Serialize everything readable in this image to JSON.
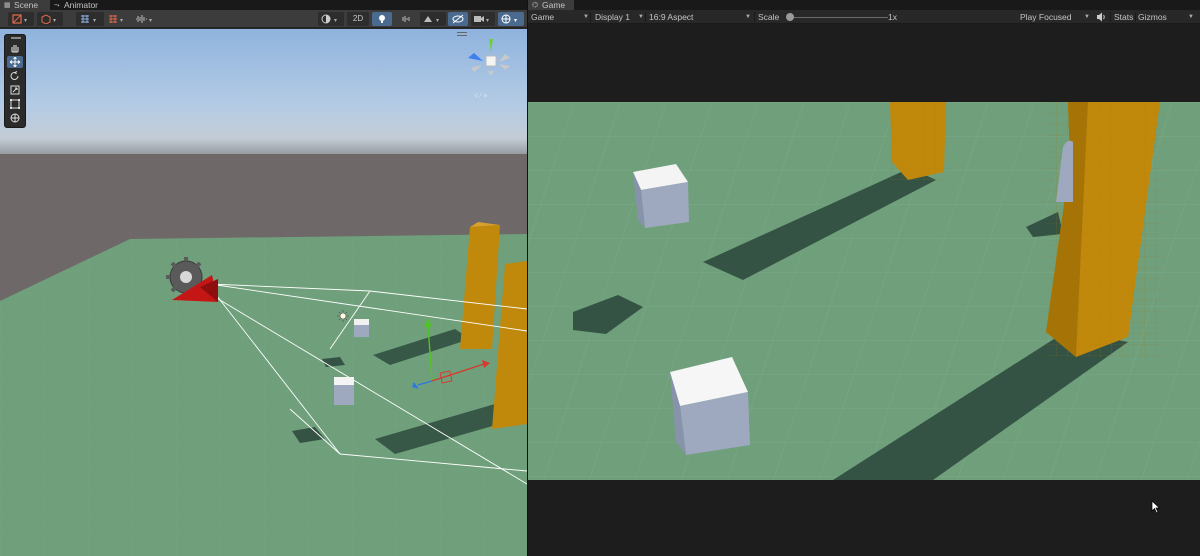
{
  "scene_panel": {
    "tabs": [
      {
        "label": "Scene",
        "icon": "grid-icon"
      },
      {
        "label": "Animator",
        "icon": "animator-icon"
      }
    ],
    "toolbar": {
      "two_d_label": "2D",
      "buttons": [
        "shading-mode",
        "draw-mode",
        "snap-grid",
        "grid-visibility",
        "rendering-debugger",
        "2D",
        "lighting",
        "audio",
        "effects",
        "hidden-objects",
        "camera",
        "gizmos"
      ]
    },
    "tools": [
      "hand-tool",
      "move-tool",
      "rotate-tool",
      "scale-tool",
      "rect-tool",
      "transform-tool"
    ],
    "active_tool": "move-tool"
  },
  "game_panel": {
    "tab": {
      "label": "Game",
      "icon": "gamepad-icon"
    },
    "toolbar": {
      "view_type": "Game",
      "display": "Display 1",
      "aspect": "16:9 Aspect",
      "scale_label": "Scale",
      "scale_value": "1x",
      "scale_fraction": 0.02,
      "play_mode": "Play Focused",
      "stats": "Stats",
      "gizmos": "Gizmos"
    }
  },
  "colors": {
    "ground": "#6f9f7b",
    "pillar": "#c1890c",
    "cube": "#9ea9bf",
    "sky_top": "#8fb3de",
    "sky_horizon": "#707070",
    "active_blue": "#4a6b8f"
  }
}
